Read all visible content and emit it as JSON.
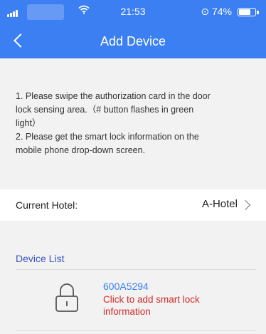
{
  "status_bar": {
    "time": "21:53",
    "battery_percent": "74%",
    "battery_level": 0.74,
    "icons": [
      "signal-icon",
      "wifi-icon",
      "alarm-icon",
      "battery-icon"
    ]
  },
  "header": {
    "title": "Add Device",
    "back_icon": "chevron-left-icon",
    "color": "#3b7ff2"
  },
  "instructions": {
    "step1_line1": "1. Please swipe the authorization card in the door",
    "step1_line2": "lock sensing area.（# button flashes in green",
    "step1_line3": "light）",
    "step2_line1": "2. Please get the smart lock information on the",
    "step2_line2": "mobile phone drop-down screen."
  },
  "hotel": {
    "label": "Current Hotel:",
    "value": "A-Hotel"
  },
  "device_list": {
    "title": "Device List",
    "title_color": "#3a55c0",
    "items": [
      {
        "id": "600A5294",
        "action_line1": "Click to add smart lock",
        "action_line2": "information",
        "icon": "lock-icon",
        "action_color": "#d02b2b"
      }
    ]
  }
}
